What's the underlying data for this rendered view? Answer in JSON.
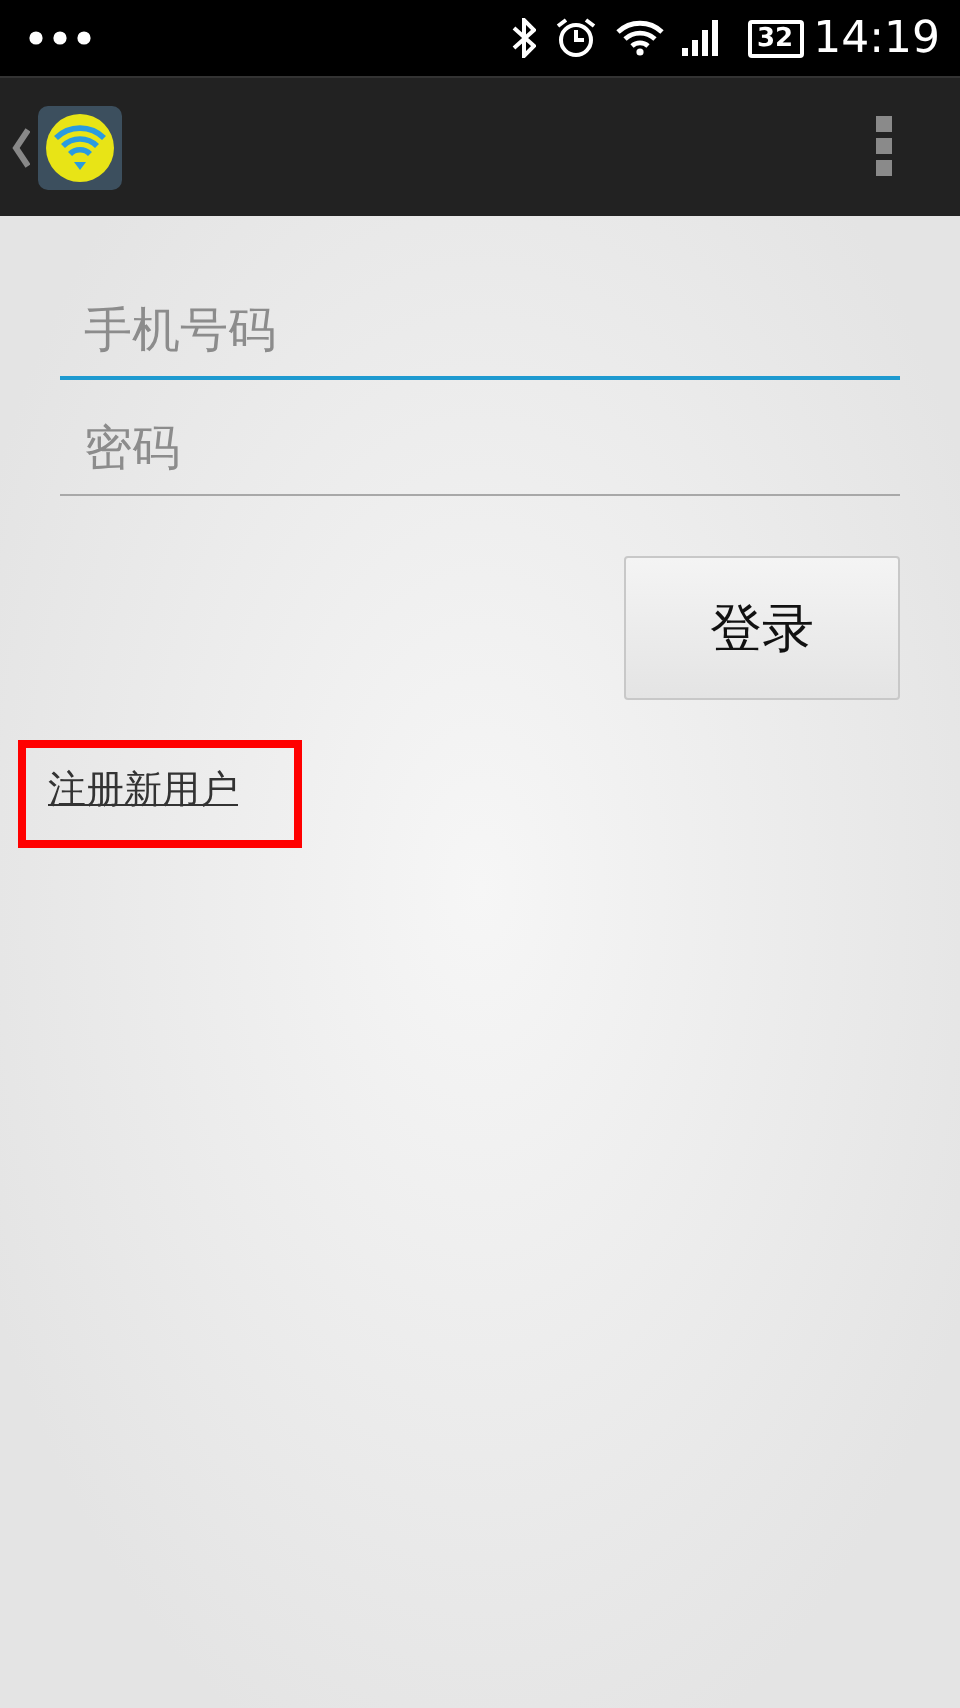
{
  "status_bar": {
    "battery": "32",
    "time": "14:19"
  },
  "fields": [
    {
      "placeholder": "手机号码",
      "focused": true
    },
    {
      "placeholder": "密码",
      "focused": false
    }
  ],
  "login_button": "登录",
  "register_link": {
    "label": "注册新用户",
    "highlighted": true
  }
}
